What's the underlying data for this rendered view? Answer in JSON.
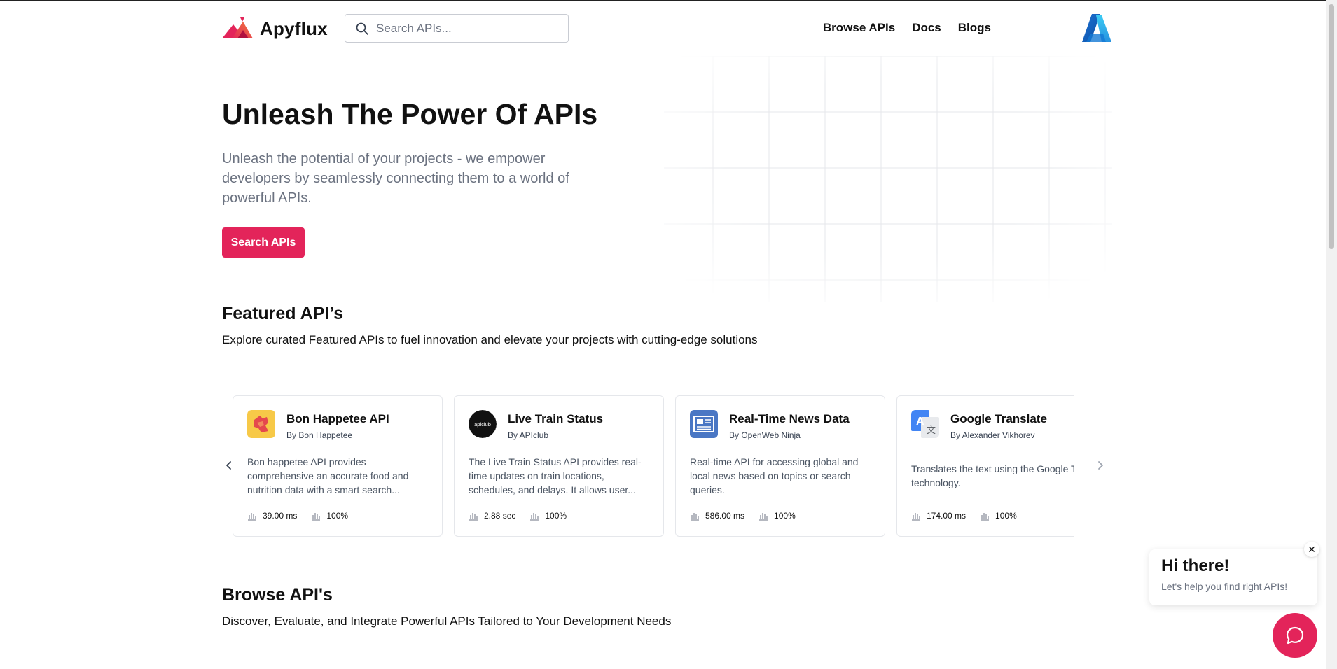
{
  "header": {
    "logo_text": "Apyflux",
    "search_placeholder": "Search APIs...",
    "nav": [
      "Browse APIs",
      "Docs",
      "Blogs"
    ]
  },
  "hero": {
    "title": "Unleash The Power Of APIs",
    "subtitle": "Unleash the potential of your projects - we empower developers by seamlessly connecting them to a world of powerful APIs.",
    "button_label": "Search APIs"
  },
  "featured": {
    "title": "Featured API’s",
    "description": "Explore curated Featured APIs to fuel innovation and elevate your projects with cutting-edge solutions",
    "cards": [
      {
        "title": "Bon Happetee API",
        "by": "By Bon Happetee",
        "description": "Bon happetee API provides comprehensive an accurate food and nutrition data with a smart search...",
        "latency": "39.00 ms",
        "uptime": "100%",
        "icon": "bon-happetee-logo-icon"
      },
      {
        "title": "Live Train Status",
        "by": "By APIclub",
        "description": "The Live Train Status API provides real-time updates on train locations, schedules, and delays. It allows user...",
        "latency": "2.88 sec",
        "uptime": "100%",
        "icon": "apiclub-logo-icon",
        "icon_text": "apiclub"
      },
      {
        "title": "Real-Time News Data",
        "by": "By OpenWeb Ninja",
        "description": "Real-time API for accessing global and local news based on topics or search queries.",
        "latency": "586.00 ms",
        "uptime": "100%",
        "icon": "newspaper-icon"
      },
      {
        "title": "Google Translate",
        "by": "By Alexander Vikhorev",
        "description": "Translates the text using the Google Translate technology.",
        "latency": "174.00 ms",
        "uptime": "100%",
        "icon": "translate-icon"
      }
    ]
  },
  "browse": {
    "title": "Browse API's",
    "description": "Discover, Evaluate, and Integrate Powerful APIs Tailored to Your Development Needs"
  },
  "chat": {
    "title": "Hi there!",
    "subtitle": "Let's help you find right APIs!",
    "close_glyph": "✕"
  },
  "colors": {
    "accent": "#e3245a",
    "text_muted": "#6b7280"
  }
}
